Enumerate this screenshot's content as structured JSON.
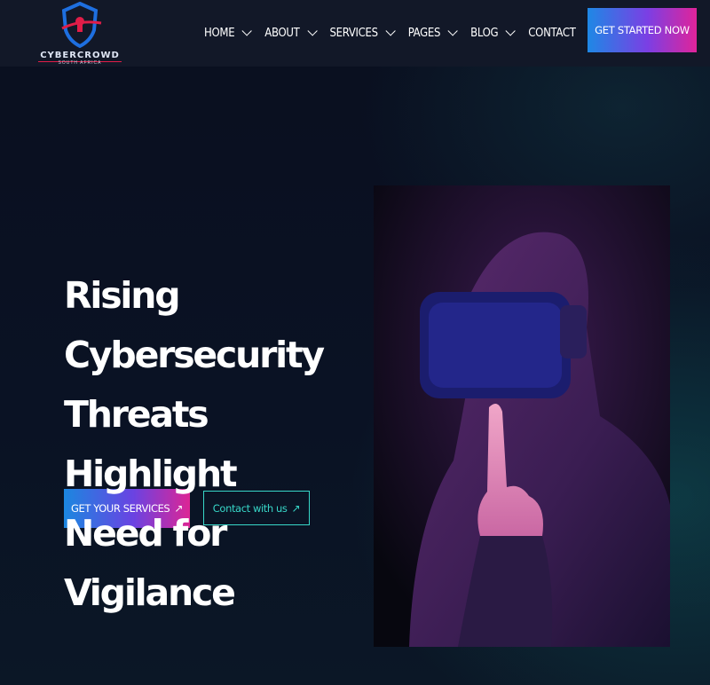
{
  "brand": {
    "name": "CYBERCROWD",
    "tagline": "SOUTH AFRICA"
  },
  "nav": {
    "items": [
      {
        "label": "HOME",
        "dropdown": true
      },
      {
        "label": "ABOUT",
        "dropdown": true
      },
      {
        "label": "SERVICES",
        "dropdown": true
      },
      {
        "label": "PAGES",
        "dropdown": true
      },
      {
        "label": "BLOG",
        "dropdown": true
      },
      {
        "label": "CONTACT",
        "dropdown": false
      }
    ],
    "cta_label": "GET STARTED NOW"
  },
  "hero": {
    "title_lines": [
      "Rising Cybersecurity",
      "Threats Highlight",
      "Need for Vigilance"
    ],
    "primary_button": "GET YOUR SERVICES",
    "secondary_button": "Contact with us",
    "arrow_glyph": "↗"
  },
  "colors": {
    "background": "#0b1020",
    "header": "#121828",
    "accent_teal": "#37d7c8",
    "gradient_start": "#1e88e5",
    "gradient_end": "#e0249a"
  }
}
